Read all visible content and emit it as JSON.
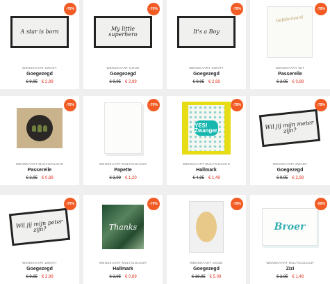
{
  "products": [
    {
      "badge": "-70%",
      "category": "WENSKAART ZWART",
      "brand": "Goegezegd",
      "old_price": "€ 9,95",
      "new_price": "€ 2,99",
      "card_text": "A star is born",
      "icon": "black-frame-card"
    },
    {
      "badge": "-70%",
      "category": "WENSKAART GOUD",
      "brand": "Goegezegd",
      "old_price": "€ 9,95",
      "new_price": "€ 2,99",
      "card_text": "My little superhero",
      "icon": "black-frame-card"
    },
    {
      "badge": "-70%",
      "category": "WENSKAART ZWART",
      "brand": "Goegezegd",
      "old_price": "€ 9,95",
      "new_price": "€ 2,99",
      "card_text": "It's a Boy",
      "icon": "black-frame-card"
    },
    {
      "badge": "-70%",
      "category": "WENSKAART WIT",
      "brand": "Passerelle",
      "old_price": "€ 2,95",
      "new_price": "€ 0,89",
      "card_text": "Gefeliciteerd",
      "icon": "white-gold-card"
    },
    {
      "badge": "-70%",
      "category": "WENSKAART MULTICOLOUR",
      "brand": "Passerelle",
      "old_price": "€ 2,95",
      "new_price": "€ 0,89",
      "card_text": "",
      "icon": "cactus-card"
    },
    {
      "badge": "-70%",
      "category": "WENSKAART MULTICOLOUR",
      "brand": "Papette",
      "old_price": "€ 3,99",
      "new_price": "€ 1,20",
      "card_text": "",
      "icon": "white-text-card"
    },
    {
      "badge": "-70%",
      "category": "WENSKAART MULTICOLOUR",
      "brand": "Hallmark",
      "old_price": "€ 4,95",
      "new_price": "€ 1,49",
      "card_text": "YES! Zwanger",
      "icon": "yes-zwanger-card"
    },
    {
      "badge": "-70%",
      "category": "WENSKAART ZWART",
      "brand": "Goegezegd",
      "old_price": "€ 9,95",
      "new_price": "€ 2,99",
      "card_text": "Wil jij mijn meter zijn?",
      "icon": "black-frame-card"
    },
    {
      "badge": "-70%",
      "category": "WENSKAART ZWART",
      "brand": "Goegezegd",
      "old_price": "€ 9,95",
      "new_price": "€ 2,99",
      "card_text": "Wil jij mijn peter zijn?",
      "icon": "black-frame-card"
    },
    {
      "badge": "-70%",
      "category": "WENSKAART MULTICOLOUR",
      "brand": "Hallmark",
      "old_price": "€ 2,95",
      "new_price": "€ 0,89",
      "card_text": "Thanks",
      "icon": "jungle-card"
    },
    {
      "badge": "-70%",
      "category": "WENSKAART GOUD",
      "brand": "Goegezegd",
      "old_price": "€ 16,95",
      "new_price": "€ 5,09",
      "card_text": "",
      "icon": "gold-tag-card"
    },
    {
      "badge": "-50%",
      "category": "WENSKAART MULTICOLOUR",
      "brand": "Zizi",
      "old_price": "€ 2,95",
      "new_price": "€ 1,48",
      "card_text": "Broer",
      "icon": "broer-card"
    }
  ]
}
